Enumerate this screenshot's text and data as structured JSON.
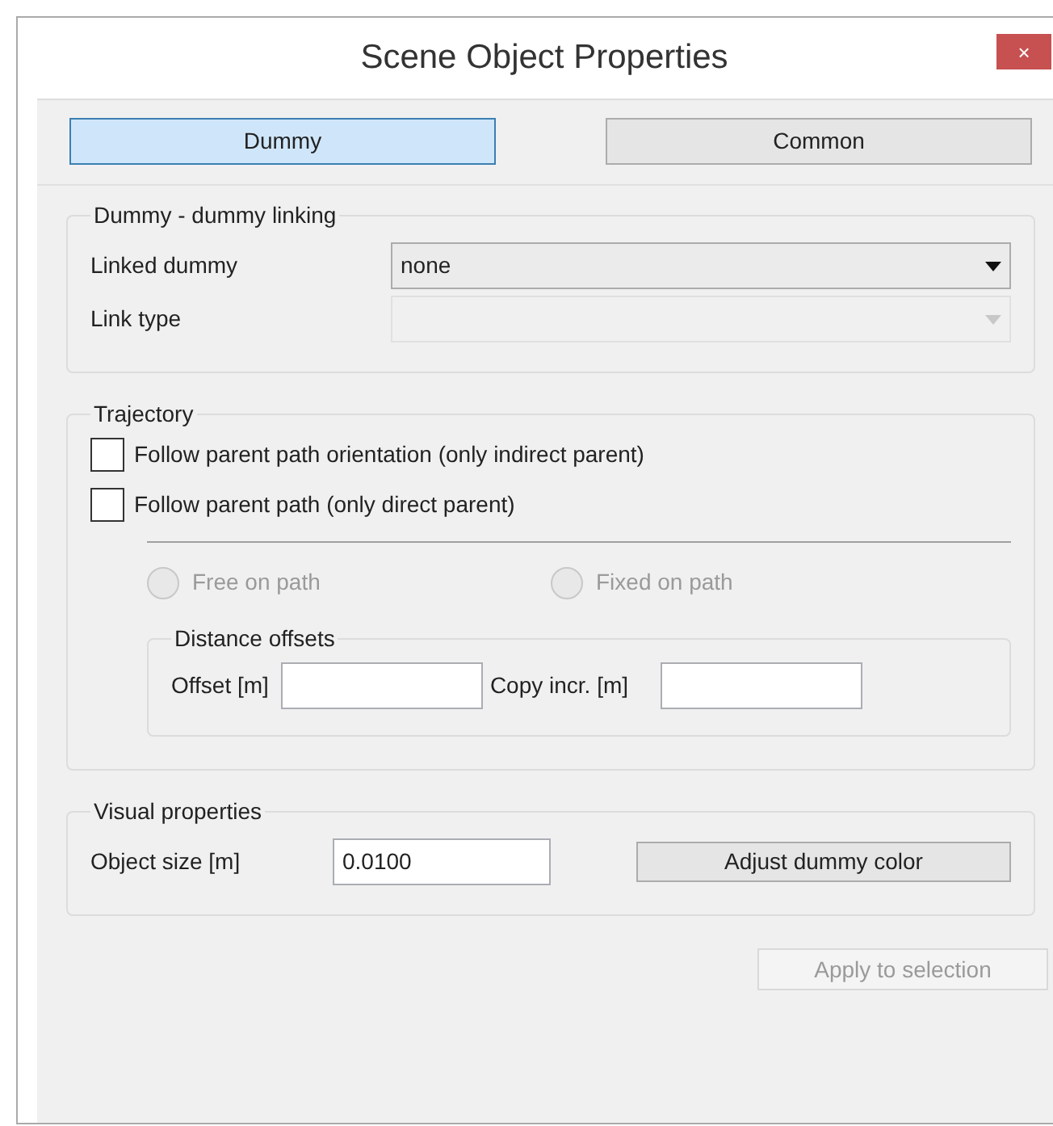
{
  "window": {
    "title": "Scene Object Properties",
    "close": "×"
  },
  "tabs": [
    {
      "label": "Dummy",
      "selected": true
    },
    {
      "label": "Common",
      "selected": false
    }
  ],
  "linking": {
    "title": "Dummy - dummy linking",
    "rows": [
      {
        "label": "Linked dummy",
        "value": "none",
        "disabled": false
      },
      {
        "label": "Link type",
        "disabled": true
      }
    ]
  },
  "trajectory": {
    "title": "Trajectory",
    "checkboxes": [
      {
        "label": "Follow parent path orientation (only indirect parent)",
        "checked": false
      },
      {
        "label": "Follow parent path (only direct parent)",
        "checked": false
      }
    ],
    "radios": [
      {
        "label": "Free on path",
        "selected": false,
        "disabled": true
      },
      {
        "label": "Fixed on path",
        "selected": false,
        "disabled": true
      }
    ],
    "offsets": {
      "title": "Distance offsets",
      "fields": [
        {
          "label": "Offset [m]"
        },
        {
          "label": "Copy incr. [m]"
        }
      ]
    }
  },
  "visual": {
    "title": "Visual properties",
    "size_label": "Object size [m]",
    "size_value": "0.0100",
    "color_button": "Adjust dummy color"
  },
  "apply_button": {
    "label": "Apply to selection",
    "disabled": true
  }
}
